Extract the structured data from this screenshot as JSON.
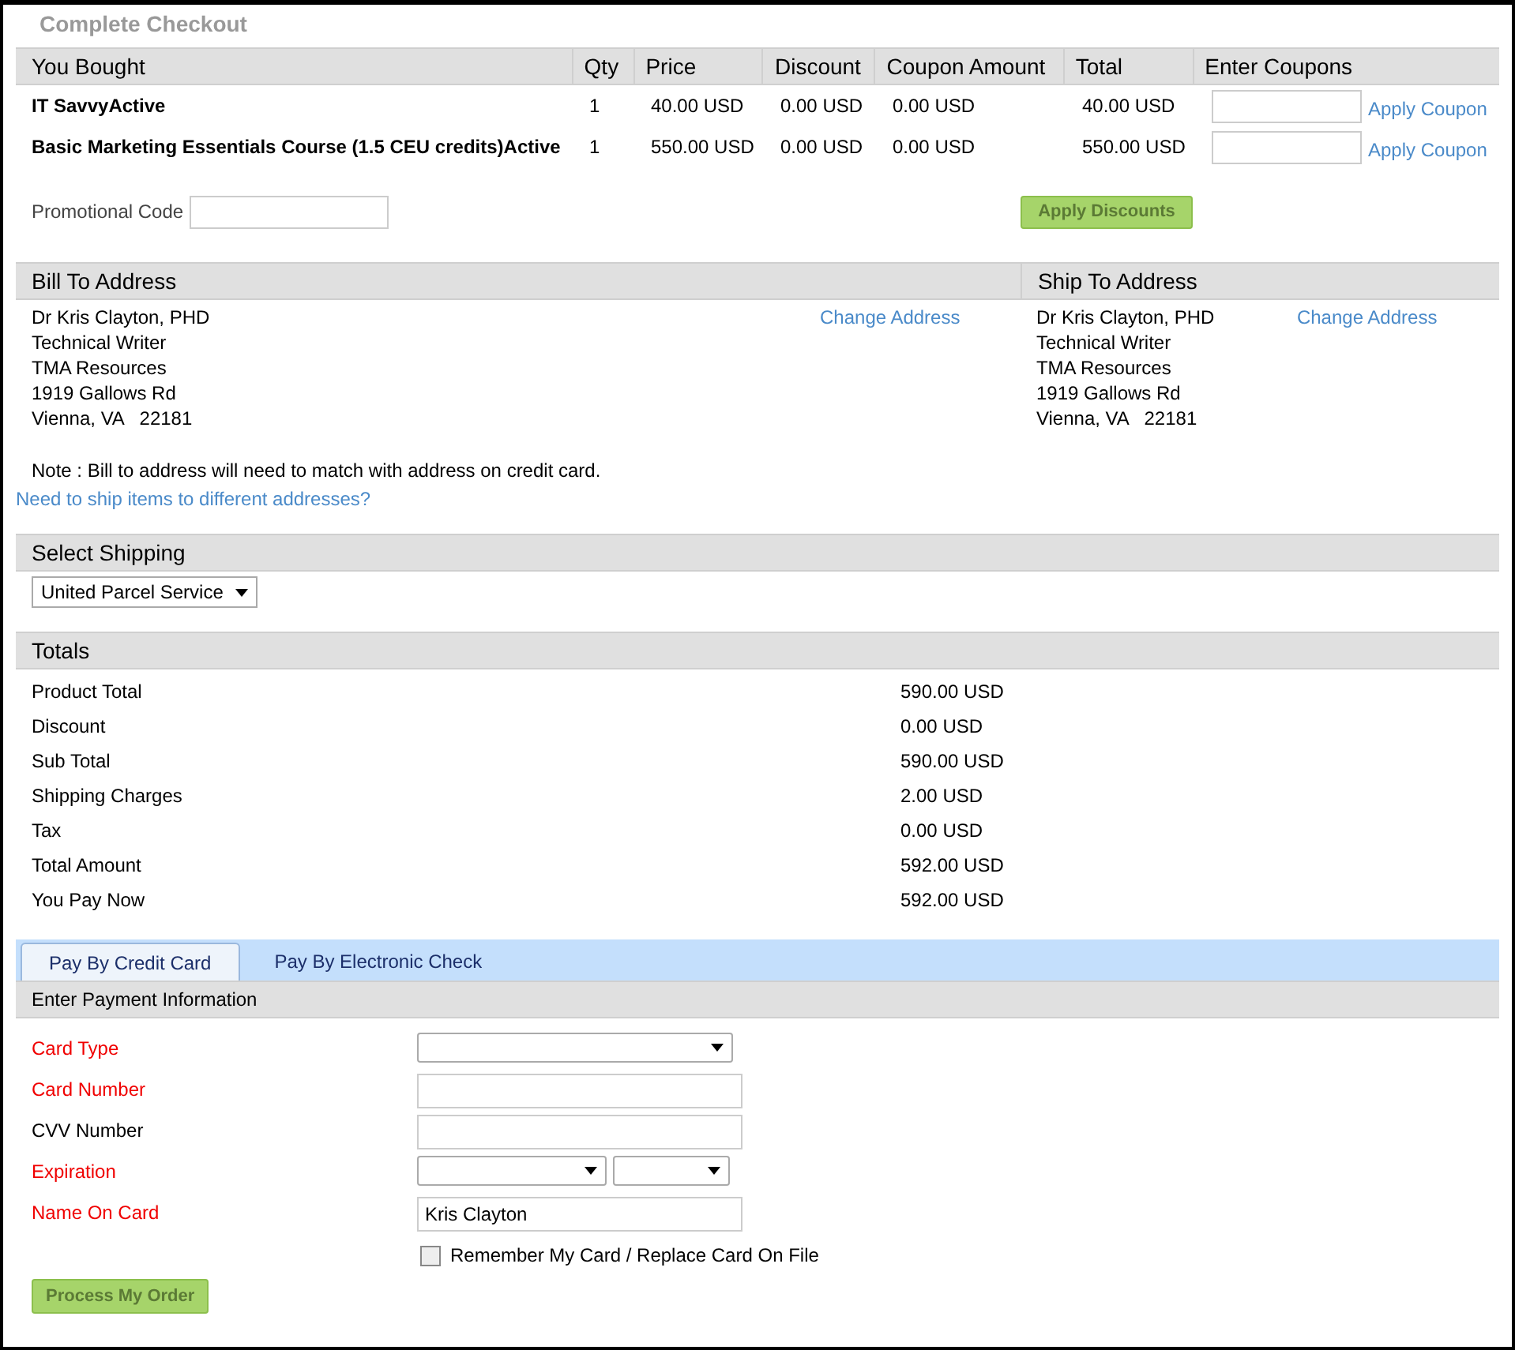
{
  "title": "Complete Checkout",
  "cart": {
    "columns": [
      "You Bought",
      "Qty",
      "Price",
      "Discount",
      "Coupon Amount",
      "Total",
      "Enter Coupons"
    ],
    "rows": [
      {
        "item": "IT SavvyActive",
        "qty": "1",
        "price": "40.00 USD",
        "discount": "0.00 USD",
        "coupon_amount": "0.00 USD",
        "total": "40.00 USD",
        "apply": "Apply Coupon"
      },
      {
        "item": "Basic Marketing Essentials Course (1.5 CEU credits)Active",
        "qty": "1",
        "price": "550.00 USD",
        "discount": "0.00 USD",
        "coupon_amount": "0.00 USD",
        "total": "550.00 USD",
        "apply": "Apply Coupon"
      }
    ]
  },
  "promo": {
    "label": "Promotional Code",
    "button": "Apply Discounts"
  },
  "addresses": [
    {
      "heading": "Bill To Address",
      "lines": [
        "Dr Kris Clayton, PHD",
        "Technical Writer",
        "TMA Resources",
        "1919 Gallows Rd",
        "Vienna, VA   22181"
      ],
      "link": "Change Address"
    },
    {
      "heading": "Ship To Address",
      "lines": [
        "Dr Kris Clayton, PHD",
        "Technical Writer",
        "TMA Resources",
        "1919 Gallows Rd",
        "Vienna, VA   22181"
      ],
      "link": "Change Address"
    }
  ],
  "note": "Note : Bill to address will need to match with address on credit card.",
  "ship_link": "Need to ship items to different addresses?",
  "shipping": {
    "heading": "Select Shipping",
    "value": "United Parcel Service"
  },
  "totals": {
    "heading": "Totals",
    "rows": [
      {
        "label": "Product Total",
        "value": "590.00 USD"
      },
      {
        "label": "Discount",
        "value": "0.00 USD"
      },
      {
        "label": "Sub Total",
        "value": "590.00 USD"
      },
      {
        "label": "Shipping Charges",
        "value": "2.00 USD"
      },
      {
        "label": "Tax",
        "value": "0.00 USD"
      },
      {
        "label": "Total Amount",
        "value": "592.00 USD"
      },
      {
        "label": "You Pay Now",
        "value": "592.00 USD"
      }
    ]
  },
  "payment": {
    "tabs": [
      {
        "label": "Pay By Credit Card",
        "selected": true
      },
      {
        "label": "Pay By Electronic Check",
        "selected": false
      }
    ],
    "heading": "Enter Payment Information",
    "fields": [
      {
        "label": "Card Type",
        "required": true,
        "kind": "select"
      },
      {
        "label": "Card Number",
        "required": true,
        "kind": "input"
      },
      {
        "label": "CVV Number",
        "required": false,
        "kind": "input"
      },
      {
        "label": "Expiration",
        "required": true,
        "kind": "select_pair"
      },
      {
        "label": "Name On Card",
        "required": true,
        "kind": "input",
        "value": "Kris Clayton"
      }
    ],
    "remember": {
      "label": "Remember My Card / Replace Card On File",
      "checked": false
    },
    "button": "Process My Order"
  }
}
